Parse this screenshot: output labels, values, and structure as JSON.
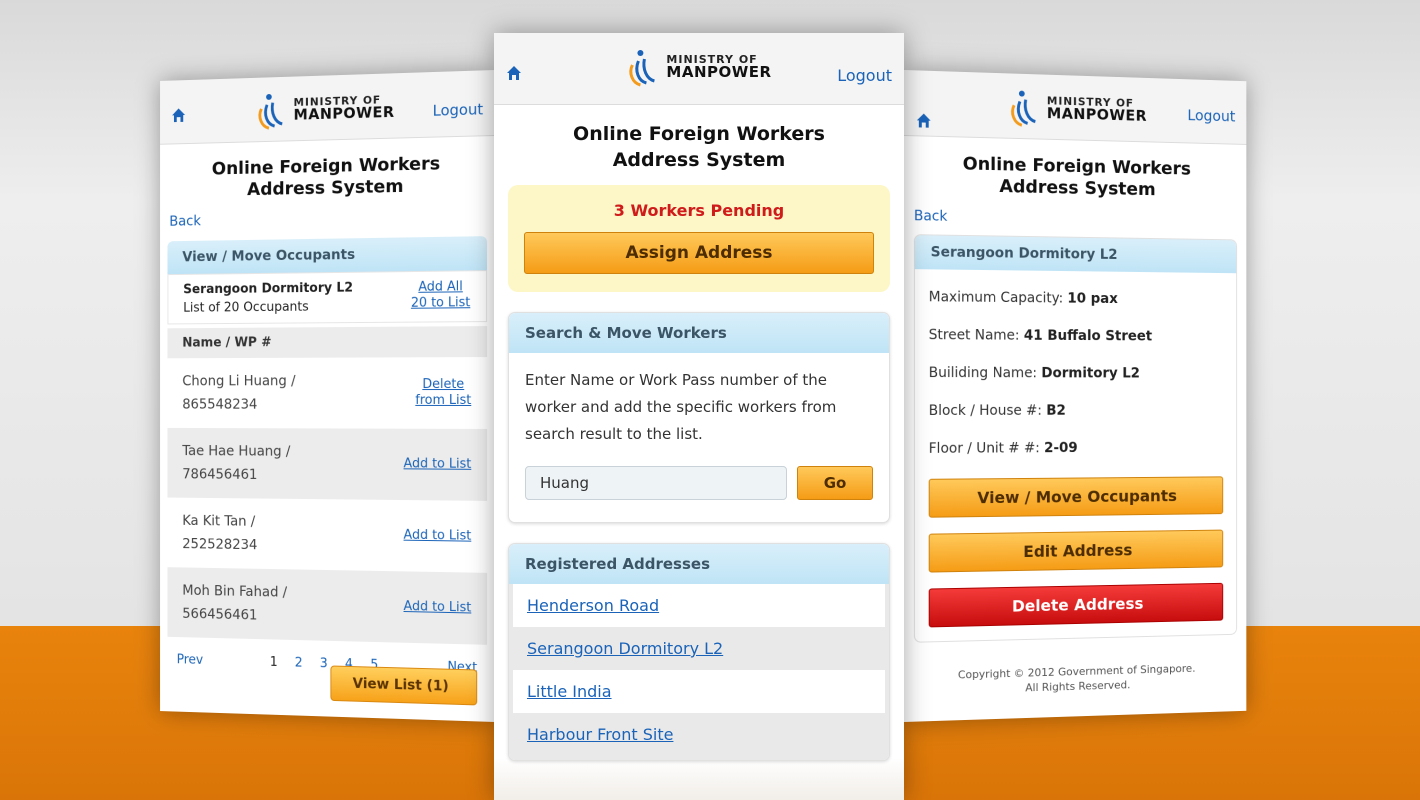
{
  "brand": {
    "logo_line1": "MINISTRY OF",
    "logo_line2": "MANPOWER",
    "app_title_line1": "Online Foreign Workers",
    "app_title_line2": "Address System",
    "logout": "Logout",
    "back": "Back",
    "orange": "#F59C16",
    "blue_link": "#1A63B8",
    "red_alert": "#D01B1B"
  },
  "left": {
    "section_title": "View / Move Occupants",
    "dorm_name": "Serangoon Dormitory L2",
    "occupant_count_text": "List of 20 Occupants",
    "add_all_line1": "Add All",
    "add_all_line2": "20 to List",
    "col_header": "Name / WP #",
    "occupants": [
      {
        "name": "Chong Li Huang /",
        "wp": "865548234",
        "action_line1": "Delete",
        "action_line2": "from List"
      },
      {
        "name": "Tae Hae Huang /",
        "wp": "786456461",
        "action_line1": "Add to List",
        "action_line2": ""
      },
      {
        "name": "Ka Kit Tan /",
        "wp": "252528234",
        "action_line1": "Add to List",
        "action_line2": ""
      },
      {
        "name": "Moh Bin Fahad /",
        "wp": "566456461",
        "action_line1": "Add to List",
        "action_line2": ""
      }
    ],
    "pager": {
      "prev": "Prev",
      "next": "Next",
      "pages": [
        "1",
        "2",
        "3",
        "4",
        "5"
      ]
    },
    "view_list_button": "View List (1)"
  },
  "center": {
    "pending_text": "3 Workers Pending",
    "assign_button": "Assign Address",
    "search_section_title": "Search & Move Workers",
    "search_instructions": "Enter Name or Work Pass number of the worker and add the specific workers from search result to the list.",
    "search_value": "Huang",
    "go_button": "Go",
    "registered_title": "Registered Addresses",
    "addresses": [
      "Henderson Road",
      "Serangoon Dormitory L2",
      "Little India",
      "Harbour Front Site"
    ]
  },
  "right": {
    "section_title": "Serangoon Dormitory L2",
    "details": [
      {
        "label": "Maximum Capacity:",
        "value": "10 pax"
      },
      {
        "label": "Street Name:",
        "value": "41 Buffalo Street"
      },
      {
        "label": "Builiding Name:",
        "value": "Dormitory L2"
      },
      {
        "label": "Block / House #:",
        "value": "B2"
      },
      {
        "label": "Floor / Unit # #:",
        "value": "2-09"
      }
    ],
    "view_move_button": "View / Move Occupants",
    "edit_button": "Edit Address",
    "delete_button": "Delete Address",
    "copyright_line1": "Copyright © 2012 Government of Singapore.",
    "copyright_line2": "All Rights Reserved."
  }
}
